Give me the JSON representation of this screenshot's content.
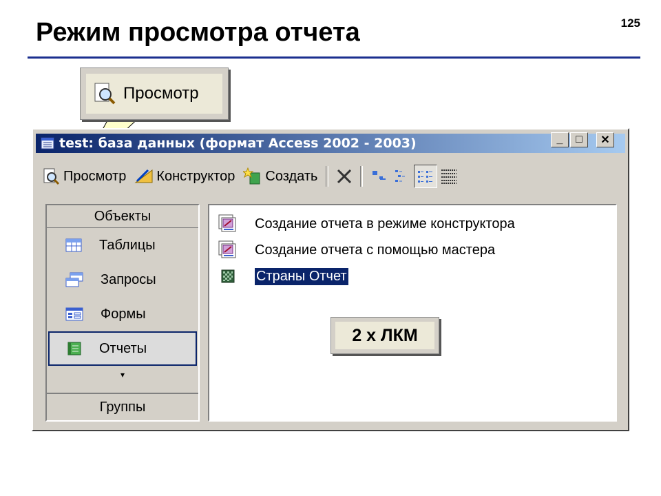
{
  "slide": {
    "title": "Режим просмотра отчета",
    "page_number": "125"
  },
  "callouts": {
    "preview_label": "Просмотр",
    "double_click_label": "2 х ЛКМ"
  },
  "window": {
    "title": "test: база данных (формат Access 2002 - 2003)",
    "controls": {
      "minimize": "_",
      "maximize": "□",
      "close": "✕"
    }
  },
  "toolbar": {
    "preview_label": "Просмотр",
    "design_label": "Конструктор",
    "create_label": "Создать"
  },
  "objects_pane": {
    "header": "Объекты",
    "items": [
      {
        "label": "Таблицы",
        "icon": "table-icon"
      },
      {
        "label": "Запросы",
        "icon": "query-icon"
      },
      {
        "label": "Формы",
        "icon": "form-icon"
      },
      {
        "label": "Отчеты",
        "icon": "report-icon",
        "selected": true
      }
    ],
    "more": "▾",
    "footer": "Группы"
  },
  "list": {
    "items": [
      {
        "label": "Создание отчета в режиме конструктора",
        "icon": "create-report-icon"
      },
      {
        "label": "Создание отчета с помощью мастера",
        "icon": "create-report-icon"
      },
      {
        "label": "Страны Отчет",
        "icon": "report-icon",
        "selected": true
      }
    ]
  },
  "colors": {
    "title_rule": "#1b2f8f",
    "titlebar": "#0a246a",
    "selection": "#0a246a"
  }
}
